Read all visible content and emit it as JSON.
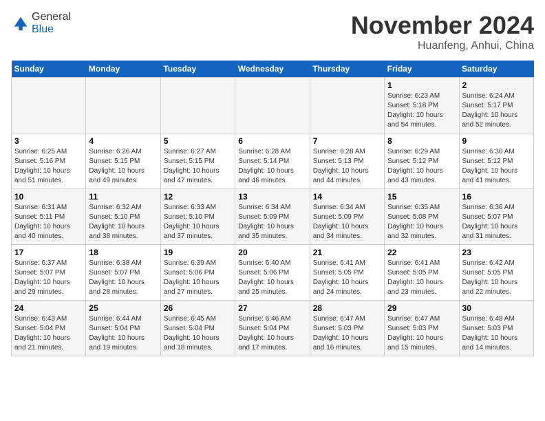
{
  "header": {
    "logo_general": "General",
    "logo_blue": "Blue",
    "title": "November 2024",
    "subtitle": "Huanfeng, Anhui, China"
  },
  "days_of_week": [
    "Sunday",
    "Monday",
    "Tuesday",
    "Wednesday",
    "Thursday",
    "Friday",
    "Saturday"
  ],
  "weeks": [
    [
      {
        "day": "",
        "info": ""
      },
      {
        "day": "",
        "info": ""
      },
      {
        "day": "",
        "info": ""
      },
      {
        "day": "",
        "info": ""
      },
      {
        "day": "",
        "info": ""
      },
      {
        "day": "1",
        "info": "Sunrise: 6:23 AM\nSunset: 5:18 PM\nDaylight: 10 hours and 54 minutes."
      },
      {
        "day": "2",
        "info": "Sunrise: 6:24 AM\nSunset: 5:17 PM\nDaylight: 10 hours and 52 minutes."
      }
    ],
    [
      {
        "day": "3",
        "info": "Sunrise: 6:25 AM\nSunset: 5:16 PM\nDaylight: 10 hours and 51 minutes."
      },
      {
        "day": "4",
        "info": "Sunrise: 6:26 AM\nSunset: 5:15 PM\nDaylight: 10 hours and 49 minutes."
      },
      {
        "day": "5",
        "info": "Sunrise: 6:27 AM\nSunset: 5:15 PM\nDaylight: 10 hours and 47 minutes."
      },
      {
        "day": "6",
        "info": "Sunrise: 6:28 AM\nSunset: 5:14 PM\nDaylight: 10 hours and 46 minutes."
      },
      {
        "day": "7",
        "info": "Sunrise: 6:28 AM\nSunset: 5:13 PM\nDaylight: 10 hours and 44 minutes."
      },
      {
        "day": "8",
        "info": "Sunrise: 6:29 AM\nSunset: 5:12 PM\nDaylight: 10 hours and 43 minutes."
      },
      {
        "day": "9",
        "info": "Sunrise: 6:30 AM\nSunset: 5:12 PM\nDaylight: 10 hours and 41 minutes."
      }
    ],
    [
      {
        "day": "10",
        "info": "Sunrise: 6:31 AM\nSunset: 5:11 PM\nDaylight: 10 hours and 40 minutes."
      },
      {
        "day": "11",
        "info": "Sunrise: 6:32 AM\nSunset: 5:10 PM\nDaylight: 10 hours and 38 minutes."
      },
      {
        "day": "12",
        "info": "Sunrise: 6:33 AM\nSunset: 5:10 PM\nDaylight: 10 hours and 37 minutes."
      },
      {
        "day": "13",
        "info": "Sunrise: 6:34 AM\nSunset: 5:09 PM\nDaylight: 10 hours and 35 minutes."
      },
      {
        "day": "14",
        "info": "Sunrise: 6:34 AM\nSunset: 5:09 PM\nDaylight: 10 hours and 34 minutes."
      },
      {
        "day": "15",
        "info": "Sunrise: 6:35 AM\nSunset: 5:08 PM\nDaylight: 10 hours and 32 minutes."
      },
      {
        "day": "16",
        "info": "Sunrise: 6:36 AM\nSunset: 5:07 PM\nDaylight: 10 hours and 31 minutes."
      }
    ],
    [
      {
        "day": "17",
        "info": "Sunrise: 6:37 AM\nSunset: 5:07 PM\nDaylight: 10 hours and 29 minutes."
      },
      {
        "day": "18",
        "info": "Sunrise: 6:38 AM\nSunset: 5:07 PM\nDaylight: 10 hours and 28 minutes."
      },
      {
        "day": "19",
        "info": "Sunrise: 6:39 AM\nSunset: 5:06 PM\nDaylight: 10 hours and 27 minutes."
      },
      {
        "day": "20",
        "info": "Sunrise: 6:40 AM\nSunset: 5:06 PM\nDaylight: 10 hours and 25 minutes."
      },
      {
        "day": "21",
        "info": "Sunrise: 6:41 AM\nSunset: 5:05 PM\nDaylight: 10 hours and 24 minutes."
      },
      {
        "day": "22",
        "info": "Sunrise: 6:41 AM\nSunset: 5:05 PM\nDaylight: 10 hours and 23 minutes."
      },
      {
        "day": "23",
        "info": "Sunrise: 6:42 AM\nSunset: 5:05 PM\nDaylight: 10 hours and 22 minutes."
      }
    ],
    [
      {
        "day": "24",
        "info": "Sunrise: 6:43 AM\nSunset: 5:04 PM\nDaylight: 10 hours and 21 minutes."
      },
      {
        "day": "25",
        "info": "Sunrise: 6:44 AM\nSunset: 5:04 PM\nDaylight: 10 hours and 19 minutes."
      },
      {
        "day": "26",
        "info": "Sunrise: 6:45 AM\nSunset: 5:04 PM\nDaylight: 10 hours and 18 minutes."
      },
      {
        "day": "27",
        "info": "Sunrise: 6:46 AM\nSunset: 5:04 PM\nDaylight: 10 hours and 17 minutes."
      },
      {
        "day": "28",
        "info": "Sunrise: 6:47 AM\nSunset: 5:03 PM\nDaylight: 10 hours and 16 minutes."
      },
      {
        "day": "29",
        "info": "Sunrise: 6:47 AM\nSunset: 5:03 PM\nDaylight: 10 hours and 15 minutes."
      },
      {
        "day": "30",
        "info": "Sunrise: 6:48 AM\nSunset: 5:03 PM\nDaylight: 10 hours and 14 minutes."
      }
    ]
  ]
}
